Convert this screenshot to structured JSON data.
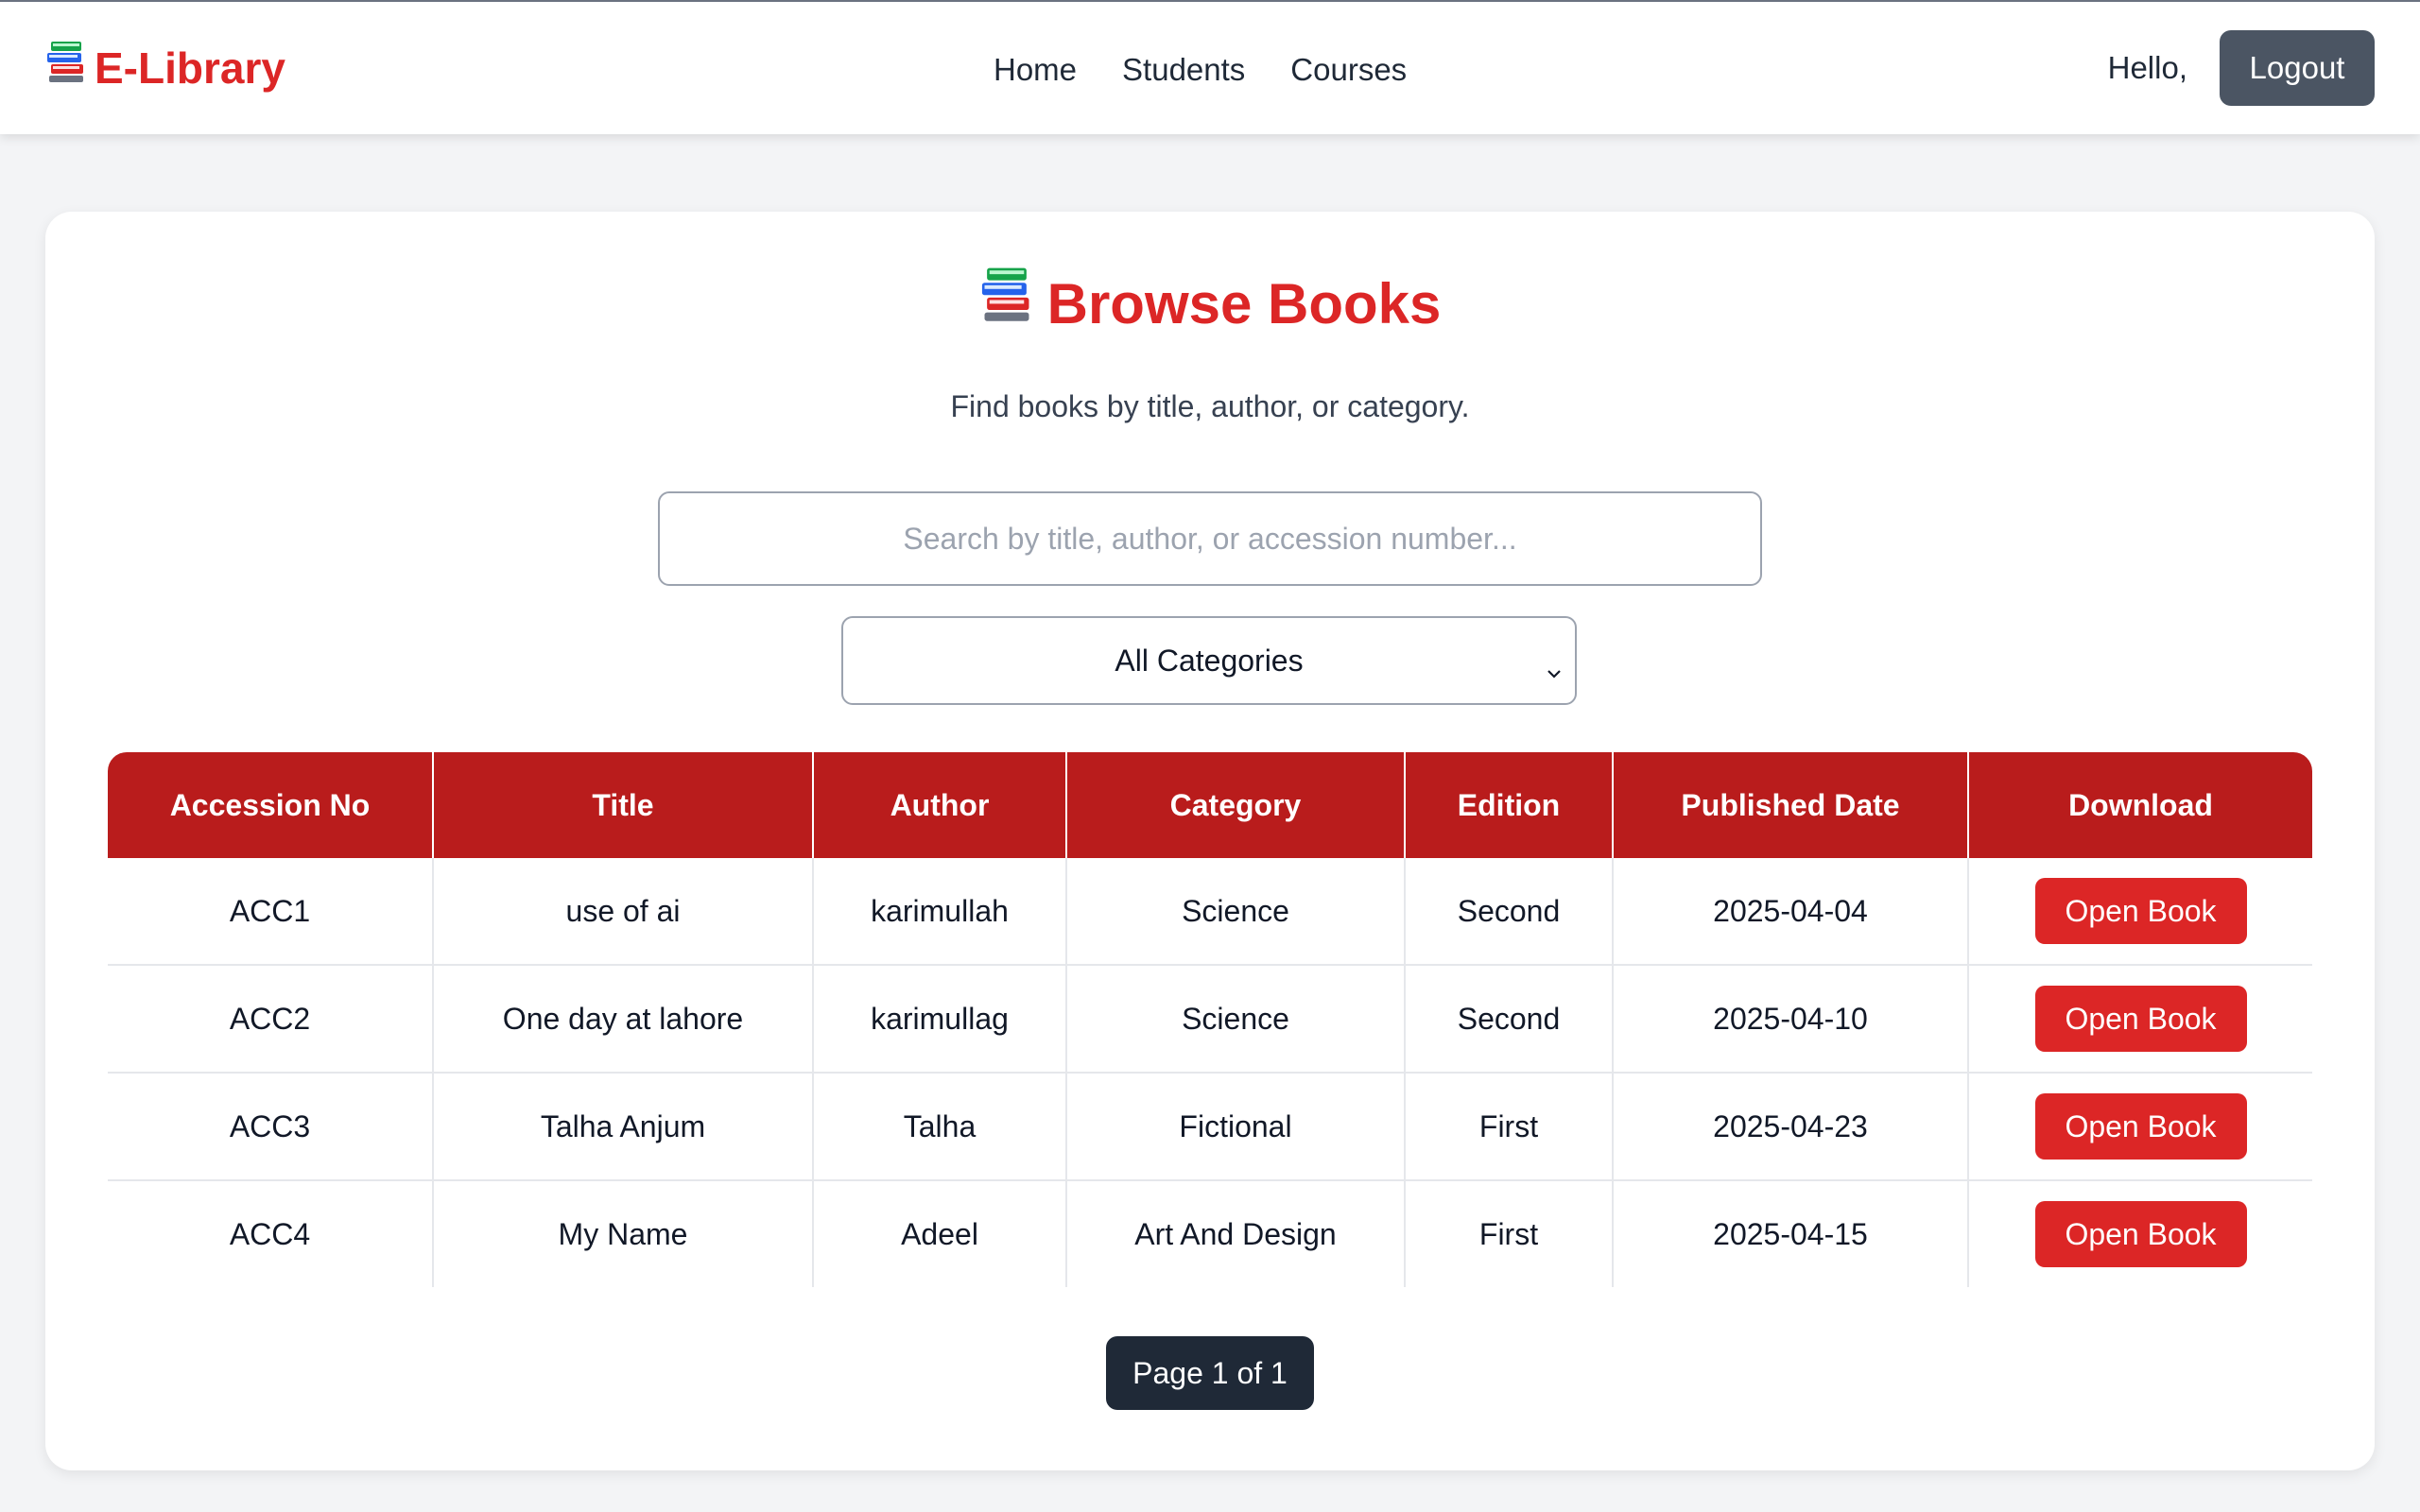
{
  "navbar": {
    "brand": "E-Library",
    "brand_icon": "books-icon",
    "links": [
      "Home",
      "Students",
      "Courses"
    ],
    "greeting": "Hello,",
    "logout_label": "Logout"
  },
  "main": {
    "title": "Browse Books",
    "subtitle": "Find books by title, author, or category.",
    "search_placeholder": "Search by title, author, or accession number...",
    "search_value": "",
    "category_selected": "All Categories"
  },
  "table": {
    "headers": [
      "Accession No",
      "Title",
      "Author",
      "Category",
      "Edition",
      "Published Date",
      "Download"
    ],
    "rows": [
      {
        "accession": "ACC1",
        "title": "use of ai",
        "author": "karimullah",
        "category": "Science",
        "edition": "Second",
        "published": "2025-04-04",
        "action": "Open Book"
      },
      {
        "accession": "ACC2",
        "title": "One day at lahore",
        "author": "karimullag",
        "category": "Science",
        "edition": "Second",
        "published": "2025-04-10",
        "action": "Open Book"
      },
      {
        "accession": "ACC3",
        "title": "Talha Anjum",
        "author": "Talha",
        "category": "Fictional",
        "edition": "First",
        "published": "2025-04-23",
        "action": "Open Book"
      },
      {
        "accession": "ACC4",
        "title": "My Name",
        "author": "Adeel",
        "category": "Art And Design",
        "edition": "First",
        "published": "2025-04-15",
        "action": "Open Book"
      }
    ]
  },
  "pagination": {
    "label": "Page 1 of 1"
  },
  "colors": {
    "brand_red": "#dc2626",
    "header_red": "#b91c1c",
    "logout_gray": "#4b5563",
    "pagination_dark": "#1f2937",
    "page_background": "#f3f4f6"
  }
}
